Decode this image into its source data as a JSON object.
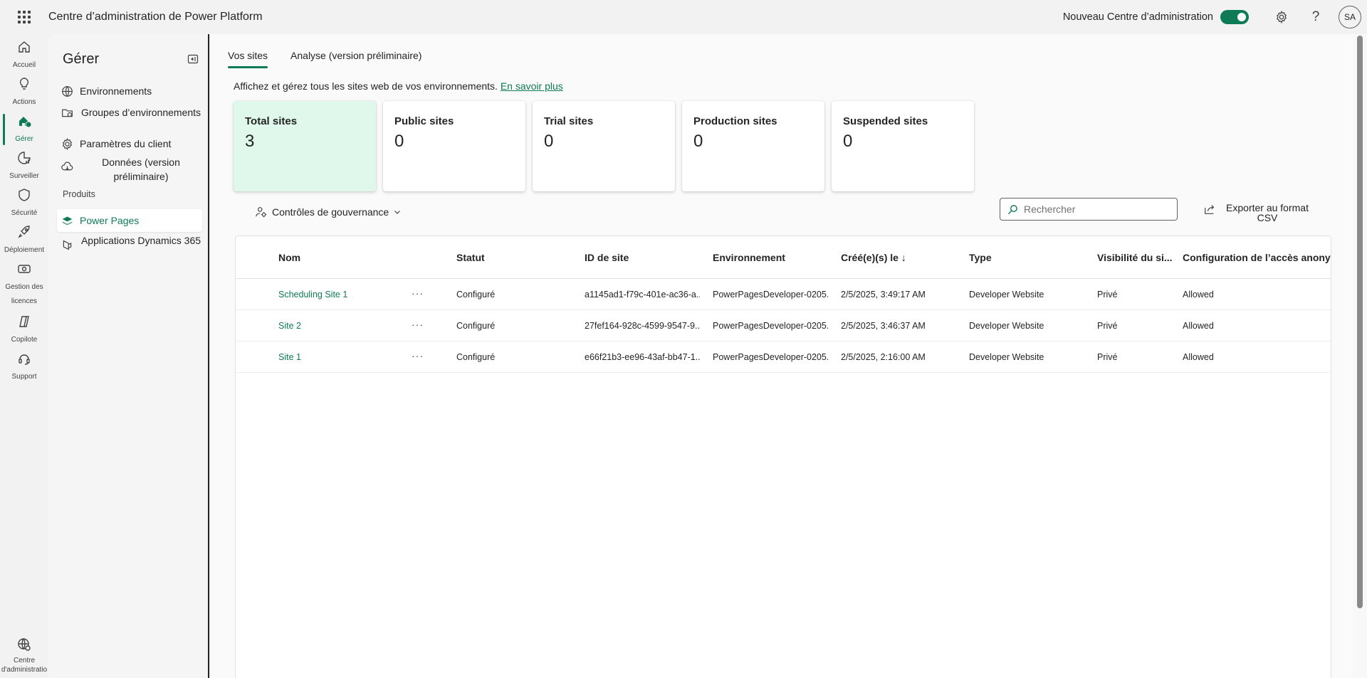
{
  "app": {
    "title": "Centre d’administration de Power Platform",
    "new_center_label": "Nouveau Centre d’administration",
    "new_center_enabled": true,
    "avatar_initials": "SA",
    "accent_color": "#0e7a56"
  },
  "rail": {
    "items": [
      {
        "label": "Accueil",
        "icon": "home-icon"
      },
      {
        "label": "Actions",
        "icon": "lightbulb-icon"
      },
      {
        "label": "Gérer",
        "icon": "manage-icon",
        "active": true
      },
      {
        "label": "Surveiller",
        "icon": "monitor-icon"
      },
      {
        "label": "Sécurité",
        "icon": "shield-icon"
      },
      {
        "label": "Déploiement",
        "icon": "rocket-icon"
      },
      {
        "label": "Gestion des licences",
        "icon": "license-icon"
      },
      {
        "label": "Copilote",
        "icon": "copilot-icon"
      },
      {
        "label": "Support",
        "icon": "headset-icon"
      }
    ],
    "bottom_label": "Centre d'administratio"
  },
  "manage": {
    "title": "Gérer",
    "items": [
      {
        "label": "Environnements",
        "icon": "globe-icon"
      },
      {
        "label": "Groupes d’environnements",
        "icon": "folder-globe-icon"
      },
      {
        "label": "Paramètres du client",
        "icon": "gear-icon"
      },
      {
        "label": "Données (version préliminaire)",
        "icon": "cloud-icon"
      }
    ],
    "products_label": "Produits",
    "products": [
      {
        "label": "Power Pages",
        "icon": "power-pages-icon",
        "selected": true
      },
      {
        "label": "Applications Dynamics 365",
        "icon": "dynamics-icon"
      }
    ]
  },
  "tabs": [
    {
      "label": "Vos sites",
      "active": true
    },
    {
      "label": "Analyse (version préliminaire)"
    }
  ],
  "description": {
    "text": "Affichez et gérez tous les sites web de vos environnements.",
    "link": "En savoir plus"
  },
  "cards": [
    {
      "label": "Total sites",
      "value": "3"
    },
    {
      "label": "Public sites",
      "value": "0"
    },
    {
      "label": "Trial sites",
      "value": "0"
    },
    {
      "label": "Production sites",
      "value": "0"
    },
    {
      "label": "Suspended sites",
      "value": "0"
    }
  ],
  "toolbar": {
    "governance_label": "Contrôles de gouvernance",
    "search_placeholder": "Rechercher",
    "export_label": "Exporter au format CSV"
  },
  "table": {
    "columns": [
      "Nom",
      "Statut",
      "ID de site",
      "Environnement",
      "Créé(e)(s) le ↓",
      "Type",
      "Visibilité du si...",
      "Configuration de l’accès anonym"
    ],
    "rows": [
      [
        "Scheduling Site 1",
        "Configuré",
        "a1145ad1-f79c-401e-ac36-a...",
        "PowerPagesDeveloper-0205...",
        "2/5/2025, 3:49:17 AM",
        "Developer Website",
        "Privé",
        "Allowed"
      ],
      [
        "Site 2",
        "Configuré",
        "27fef164-928c-4599-9547-9...",
        "PowerPagesDeveloper-0205...",
        "2/5/2025, 3:46:37 AM",
        "Developer Website",
        "Privé",
        "Allowed"
      ],
      [
        "Site 1",
        "Configuré",
        "e66f21b3-ee96-43af-bb47-1...",
        "PowerPagesDeveloper-0205...",
        "2/5/2025, 2:16:00 AM",
        "Developer Website",
        "Privé",
        "Allowed"
      ]
    ],
    "more_label": "···"
  }
}
